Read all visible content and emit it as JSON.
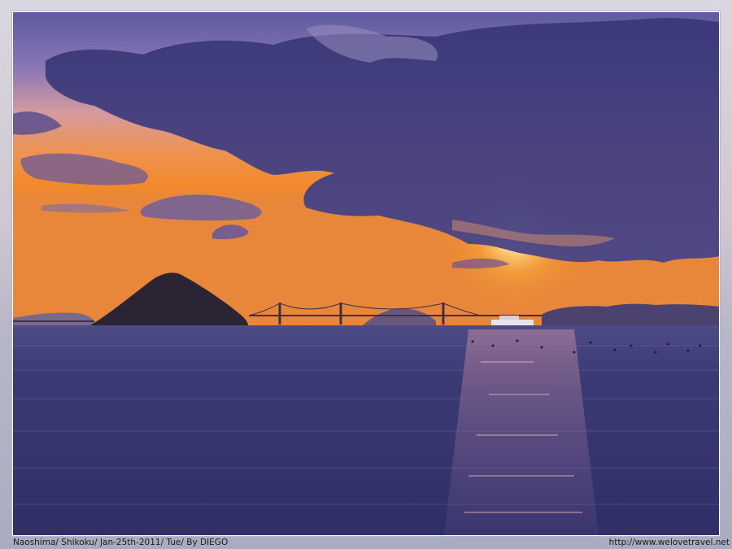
{
  "caption": {
    "left": "Naoshima/ Shikoku/ Jan-25th-2011/ Tue/ By DIEGO",
    "right": "http://www.welovetravel.net"
  },
  "colors": {
    "sky_top": "#4a4a8a",
    "sky_sunset": "#f08a2a",
    "cloud_dark": "#3c3a78",
    "sea": "#34336a",
    "sun": "#fff4c8"
  }
}
